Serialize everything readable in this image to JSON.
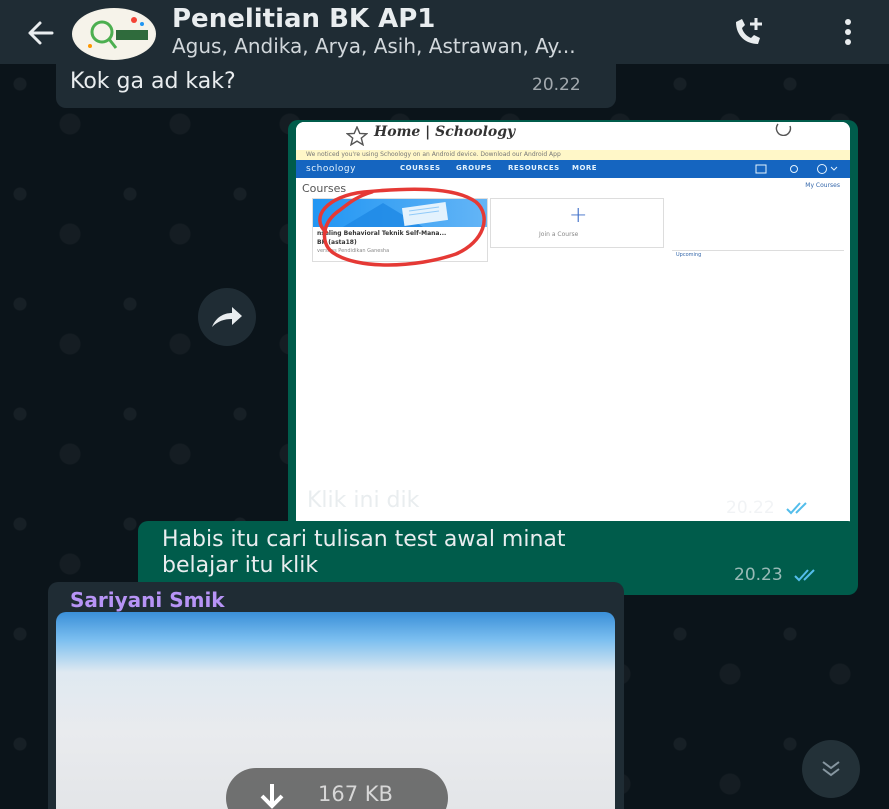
{
  "header": {
    "title": "Penelitian BK AP1",
    "subtitle": "Agus, Andika, Arya, Asih, Astrawan, Ay...",
    "avatar_text": "RESEARCH"
  },
  "messages": [
    {
      "direction": "in",
      "text": "Kok ga ad kak?",
      "time": "20.22"
    },
    {
      "direction": "out",
      "caption": "Klik ini dik",
      "time": "20.22",
      "attachment": {
        "page_title": "Home | Schoology",
        "notice": "We noticed you're using Schoology on an Android device. Download our Android App",
        "nav_items": [
          "schoology",
          "COURSES",
          "GROUPS",
          "RESOURCES",
          "MORE"
        ],
        "section": "Courses",
        "my_courses": "My Courses",
        "course_card_line1": "nseling Behavioral Teknik Self-Mana...",
        "course_card_line2": "BK (asta18)",
        "course_card_line3": "versitas Pendidikan Ganesha",
        "join_label": "Join a Course",
        "upcoming": "Upcoming"
      }
    },
    {
      "direction": "out",
      "text_line1": "Habis itu cari tulisan test awal minat",
      "text_line2": "belajar itu klik",
      "time": "20.23"
    },
    {
      "direction": "in",
      "sender": "Sariyani Smik",
      "download_size": "167 KB"
    }
  ],
  "colors": {
    "header_bg": "#1f2c34",
    "chat_bg": "#0b141a",
    "incoming_bubble": "#1f2c34",
    "outgoing_bubble": "#005c4b",
    "read_ticks": "#53bdeb",
    "sender_name": "#b794f6"
  }
}
